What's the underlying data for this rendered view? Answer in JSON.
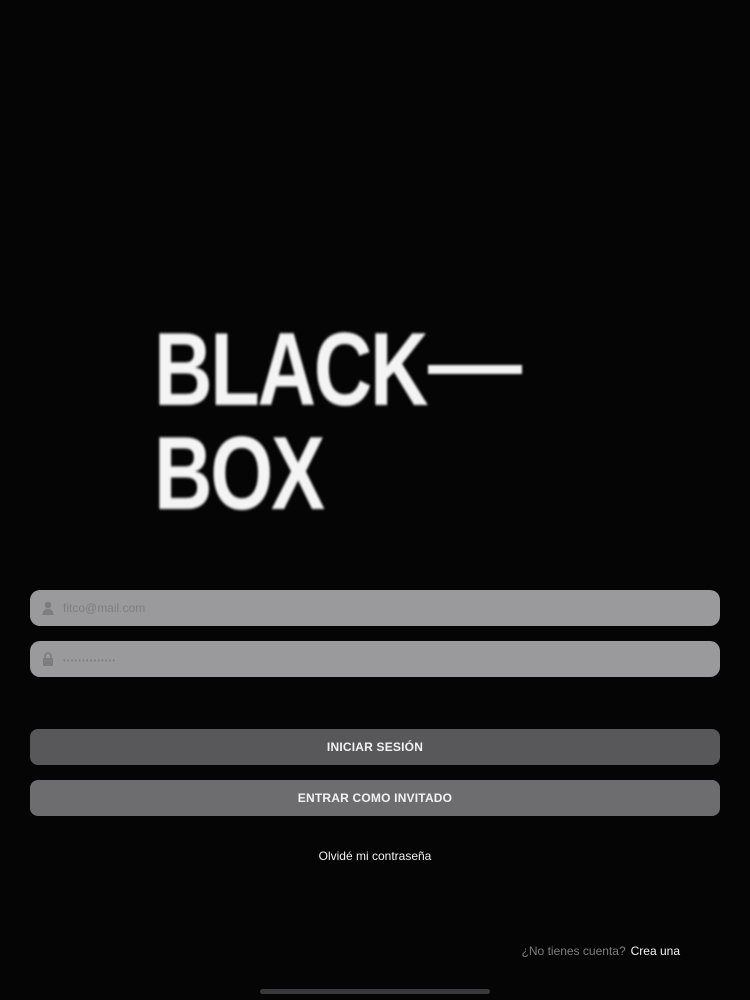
{
  "logo": {
    "line1": "BLACK",
    "line2": "BOX",
    "alt": "BLACK—BOX"
  },
  "email": {
    "placeholder": "fitco@mail.com",
    "value": "",
    "icon": "user-icon"
  },
  "password": {
    "placeholder": "••••••••••••••",
    "value": "",
    "icon": "lock-icon"
  },
  "buttons": {
    "login_label": "INICIAR SESIÓN",
    "guest_label": "ENTRAR COMO INVITADO"
  },
  "forgot_password": "Olvidé mi contraseña",
  "signup": {
    "prompt": "¿No tienes cuenta?",
    "link": "Crea una"
  },
  "colors": {
    "background": "#050505",
    "field": "#9a999b",
    "login_button": "#58575a",
    "guest_button": "#6d6c6f"
  }
}
